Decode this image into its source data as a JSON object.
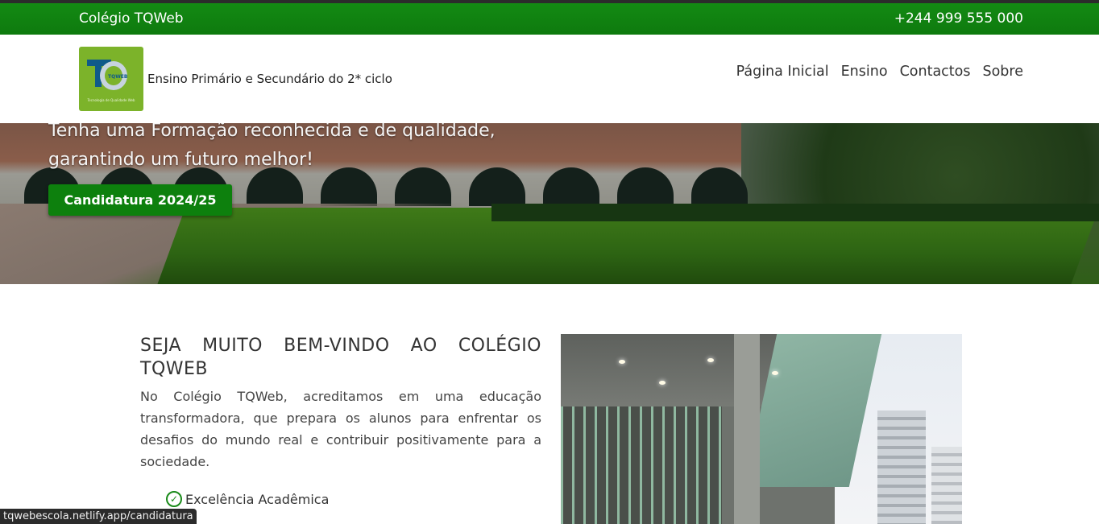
{
  "topbar": {
    "brand": "Colégio TQWeb",
    "phone": "+244 999 555 000"
  },
  "navbar": {
    "logo_text": "TQWEB",
    "logo_slogan": "Tecnologia de Qualidade Web",
    "tagline": "Ensino Primário e Secundário do 2* ciclo",
    "links": [
      "Página Inicial",
      "Ensino",
      "Contactos",
      "Sobre"
    ]
  },
  "hero": {
    "line1": "Tenha uma Formação reconhecida e de qualidade,",
    "line2": "garantindo um futuro melhor!",
    "cta_label": "Candidatura 2024/25"
  },
  "welcome": {
    "title_line1": "SEJA MUITO BEM-VINDO AO COLÉGIO",
    "title_line2": "TQWEB",
    "body": "No Colégio TQWeb, acreditamos em uma educação transformadora, que prepara os alunos para enfrentar os desafios do mundo real e contribuir positivamente para a sociedade.",
    "features": [
      "Excelência Acadêmica"
    ]
  },
  "status_url": "tqwebescola.netlify.app/candidatura",
  "colors": {
    "brand_green": "#0d800d",
    "logo_green": "#7cb32a"
  }
}
